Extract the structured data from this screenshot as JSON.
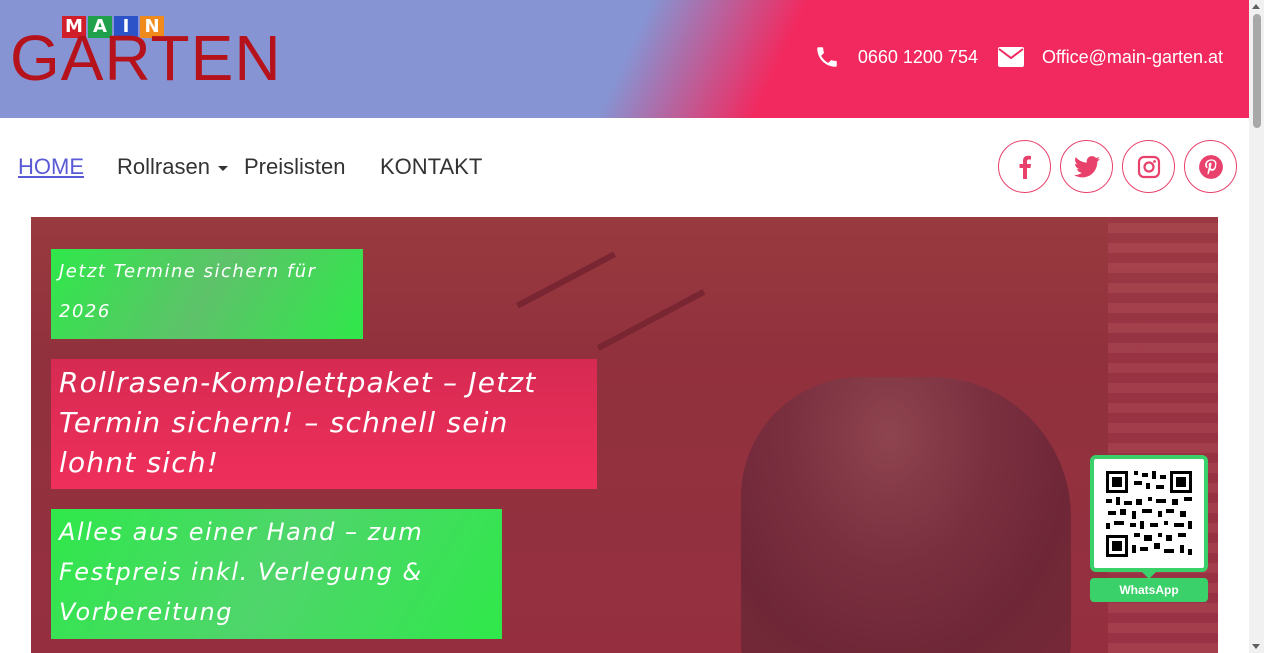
{
  "logo": {
    "main_letters": [
      "M",
      "A",
      "I",
      "N"
    ],
    "garten": "GARTEN"
  },
  "contact": {
    "phone": "0660 1200 754",
    "email": "Office@main-garten.at"
  },
  "nav": {
    "home": "HOME",
    "rollrasen": "Rollrasen",
    "preislisten": "Preislisten",
    "kontakt": "KONTAKT"
  },
  "social": [
    "facebook-icon",
    "twitter-icon",
    "instagram-icon",
    "pinterest-icon"
  ],
  "hero": {
    "box1": "Jetzt Termine sichern für 2026",
    "box2": "Rollrasen-Komplettpaket – Jetzt Termin sichern! – schnell sein lohnt sich!",
    "box3": "Alles aus einer Hand – zum Festpreis inkl. Verlegung & Vorbereitung"
  },
  "whatsapp": {
    "label": "WhatsApp"
  },
  "colors": {
    "header_left": "#8694d3",
    "header_right": "#f2295f",
    "accent_green": "#2fe84a",
    "accent_pink": "#ef2f5b"
  }
}
